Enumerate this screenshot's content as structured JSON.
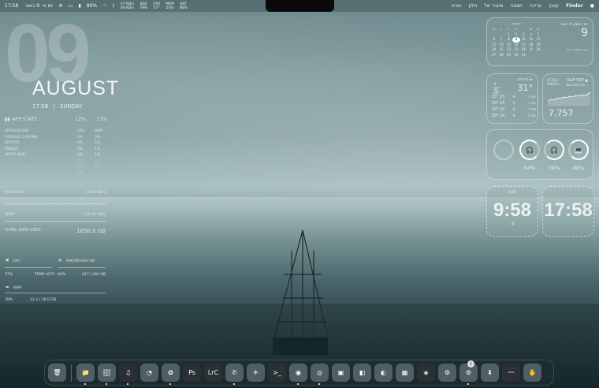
{
  "menubar": {
    "time_left": "17:58",
    "date_left": "יום א׳ 9 באוג׳",
    "battery": "80%",
    "stats": [
      {
        "top": "47 KB/s",
        "bottom": "48 KB/s"
      },
      {
        "top": "SSD",
        "bottom": "79%"
      },
      {
        "top": "CPU",
        "bottom": "57°"
      },
      {
        "top": "MEM",
        "bottom": "54%"
      },
      {
        "top": "BAT",
        "bottom": "80%"
      }
    ],
    "menus": [
      "עזרה",
      "חלון",
      "מעבר אל",
      "תצוגה",
      "עריכה",
      "קובץ"
    ],
    "app": "Finder"
  },
  "clock": {
    "day": "09",
    "month": "AUGUST",
    "time": "17:58",
    "sep": "|",
    "weekday": "SUNDAY"
  },
  "appstats": {
    "title": "APP STATS",
    "cpu_total": "12%",
    "ram_total": "11%",
    "columns": {
      "app": "APPLICATION",
      "cpu": "CPU",
      "ram": "RAM"
    },
    "rows": [
      {
        "app": "GOOGLE CHROME",
        "cpu": "2%",
        "ram": "3%"
      },
      {
        "app": "SPOTIFY",
        "cpu": "0%",
        "ram": "1%"
      },
      {
        "app": "FINDER",
        "cpu": "0%",
        "ram": "1%"
      },
      {
        "app": "APPLE MAIL",
        "cpu": "0%",
        "ram": "1%"
      },
      {
        "app": "",
        "cpu": "0%",
        "ram": "1%"
      },
      {
        "app": "מעקב אחר פעילות",
        "cpu": "0%",
        "ram": "1%"
      },
      {
        "app": "",
        "cpu": "0%",
        "ram": "1%"
      }
    ]
  },
  "network": {
    "received_label": "RECEIVED",
    "received_value": "11.39 KB/S",
    "sent_label": "SENT",
    "sent_value": "130.44 KB/S",
    "total_label": "TOTAL DATA USED",
    "total_value": "1850.0 GB"
  },
  "cpu": {
    "label": "CPU",
    "value": "37%",
    "temp_label": "TEMP ACTC",
    "temp_value": "84%"
  },
  "disk": {
    "label": "MACINTOSH HD",
    "value": "417 / 494 GB"
  },
  "ram": {
    "label": "RAM",
    "value": "78%",
    "detail": "12.3 / 16.0 GB"
  },
  "calendar": {
    "month_label": "אוגוסט",
    "weekday_headers": [
      "ב",
      "ג",
      "ד",
      "ה",
      "ו",
      "ש",
      "א"
    ],
    "weeks": [
      [
        "",
        "",
        "1",
        "2",
        "3",
        "4",
        "5"
      ],
      [
        "6",
        "7",
        "8",
        "9",
        "10",
        "11",
        "12"
      ],
      [
        "13",
        "14",
        "15",
        "16",
        "17",
        "18",
        "19"
      ],
      [
        "20",
        "21",
        "22",
        "23",
        "24",
        "25",
        "26"
      ],
      [
        "27",
        "28",
        "29",
        "30",
        "31",
        "",
        ""
      ]
    ],
    "selected": "9",
    "today_label": "יום ראשון, 9 באוג׳",
    "today_number": "9",
    "events": "אין אירועים היום"
  },
  "weather": {
    "city": "הרצליה ➤",
    "temp": "31°",
    "high_low": "33°",
    "low": "26°",
    "forecast": [
      {
        "t": "33° 23",
        "i": "☀",
        "day": "יום ב׳"
      },
      {
        "t": "33° 24",
        "i": "☀",
        "day": "יום ג׳"
      },
      {
        "t": "33° 24",
        "i": "☀",
        "day": "יום ד׳"
      },
      {
        "t": "33° 24",
        "i": "☀",
        "day": "יום ה׳"
      }
    ]
  },
  "stocks": {
    "name": "S&P 500 ▲",
    "sub": "Standard an...",
    "change1": "47.50+",
    "change2": "0.62%+",
    "price": "7,757"
  },
  "batteries": [
    {
      "icon": "",
      "pct": ""
    },
    {
      "icon": "🎧",
      "pct": "54%"
    },
    {
      "icon": "🎧",
      "pct": "74%"
    },
    {
      "icon": "💻",
      "pct": "80%"
    }
  ],
  "world_clocks": [
    {
      "loc": "LIM",
      "time": "9:58",
      "offset": "-8"
    },
    {
      "loc": "",
      "time": "17:58",
      "offset": ""
    }
  ],
  "dock": [
    "🗑",
    "📁",
    "🗄",
    "♫",
    "◔",
    "✿",
    "Ps",
    "LrC",
    "✆",
    "✈",
    ">_",
    "◉",
    "◎",
    "▣",
    "◧",
    "◐",
    "▦",
    "◈",
    "⚙",
    "⚙",
    "⬇",
    "〰",
    "✋"
  ],
  "dock_badge": "1"
}
